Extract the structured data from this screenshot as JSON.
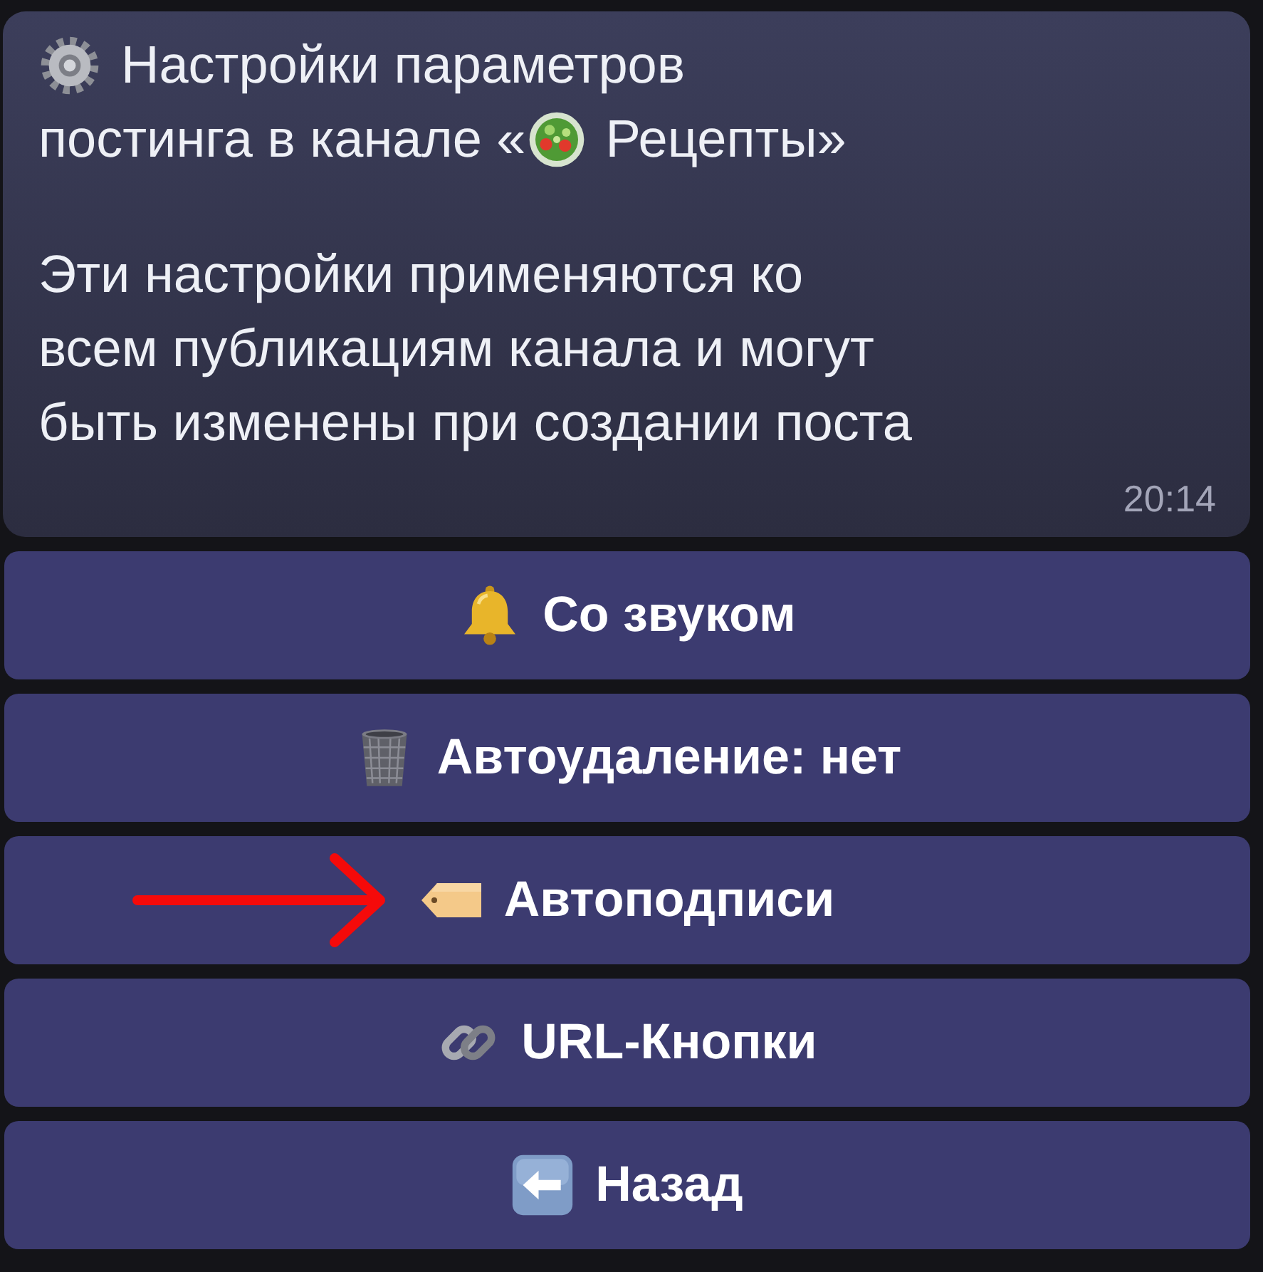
{
  "message": {
    "heading": [
      "Настройки параметров",
      "постинга в канале «"
    ],
    "channel": "Рецепты»",
    "body": "Эти настройки применяются ко\nвсем публикациям канала и могут\nбыть изменены при создании поста",
    "time": "20:14"
  },
  "buttons": [
    {
      "label": "Со звуком",
      "kind": "bell",
      "marked": false
    },
    {
      "label": "Автоудаление: нет",
      "kind": "trash",
      "marked": false
    },
    {
      "label": "Автоподписи",
      "kind": "tag",
      "marked": true
    },
    {
      "label": "URL-Кнопки",
      "kind": "link",
      "marked": false
    },
    {
      "label": "Назад",
      "kind": "back",
      "marked": false
    }
  ]
}
